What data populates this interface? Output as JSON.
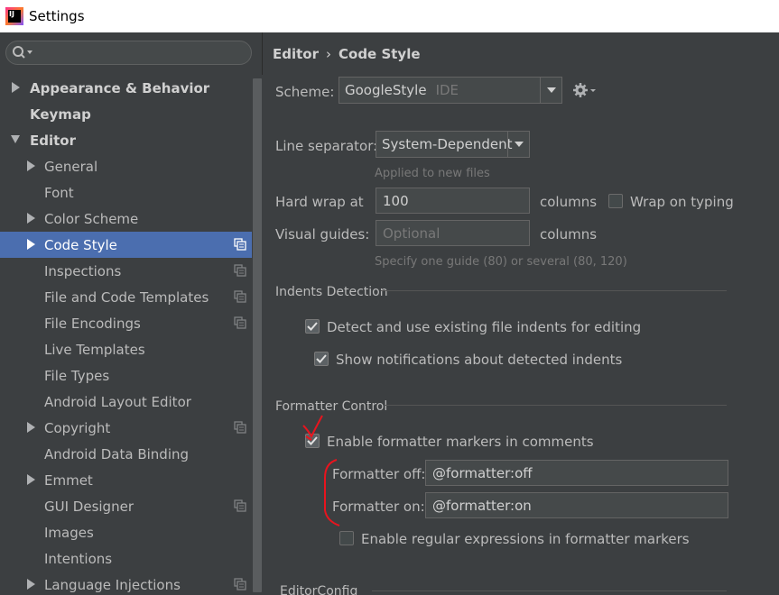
{
  "window": {
    "title": "Settings"
  },
  "search": {
    "placeholder": ""
  },
  "sidebar": {
    "items": [
      {
        "label": "Appearance & Behavior",
        "level": 0,
        "arrow": "right",
        "selected": false,
        "copy": false
      },
      {
        "label": "Keymap",
        "level": 0,
        "arrow": "none",
        "selected": false,
        "copy": false
      },
      {
        "label": "Editor",
        "level": 0,
        "arrow": "down",
        "selected": false,
        "copy": false
      },
      {
        "label": "General",
        "level": 1,
        "arrow": "right",
        "selected": false,
        "copy": false
      },
      {
        "label": "Font",
        "level": 1,
        "arrow": "none",
        "selected": false,
        "copy": false
      },
      {
        "label": "Color Scheme",
        "level": 1,
        "arrow": "right",
        "selected": false,
        "copy": false
      },
      {
        "label": "Code Style",
        "level": 1,
        "arrow": "right",
        "selected": true,
        "copy": true
      },
      {
        "label": "Inspections",
        "level": 1,
        "arrow": "none",
        "selected": false,
        "copy": true
      },
      {
        "label": "File and Code Templates",
        "level": 1,
        "arrow": "none",
        "selected": false,
        "copy": true
      },
      {
        "label": "File Encodings",
        "level": 1,
        "arrow": "none",
        "selected": false,
        "copy": true
      },
      {
        "label": "Live Templates",
        "level": 1,
        "arrow": "none",
        "selected": false,
        "copy": false
      },
      {
        "label": "File Types",
        "level": 1,
        "arrow": "none",
        "selected": false,
        "copy": false
      },
      {
        "label": "Android Layout Editor",
        "level": 1,
        "arrow": "none",
        "selected": false,
        "copy": false
      },
      {
        "label": "Copyright",
        "level": 1,
        "arrow": "right",
        "selected": false,
        "copy": true
      },
      {
        "label": "Android Data Binding",
        "level": 1,
        "arrow": "none",
        "selected": false,
        "copy": false
      },
      {
        "label": "Emmet",
        "level": 1,
        "arrow": "right",
        "selected": false,
        "copy": false
      },
      {
        "label": "GUI Designer",
        "level": 1,
        "arrow": "none",
        "selected": false,
        "copy": true
      },
      {
        "label": "Images",
        "level": 1,
        "arrow": "none",
        "selected": false,
        "copy": false
      },
      {
        "label": "Intentions",
        "level": 1,
        "arrow": "none",
        "selected": false,
        "copy": false
      },
      {
        "label": "Language Injections",
        "level": 1,
        "arrow": "right",
        "selected": false,
        "copy": true
      }
    ]
  },
  "breadcrumb": {
    "first": "Editor",
    "separator": "›",
    "second": "Code Style"
  },
  "scheme": {
    "label": "Scheme:",
    "value": "GoogleStyle",
    "scope": "IDE"
  },
  "line_separator": {
    "label": "Line separator:",
    "value": "System-Dependent",
    "hint": "Applied to new files"
  },
  "hard_wrap": {
    "label": "Hard wrap at",
    "value": "100",
    "unit": "columns",
    "wrap_on_typing_label": "Wrap on typing",
    "wrap_on_typing_checked": false
  },
  "visual_guides": {
    "label": "Visual guides:",
    "placeholder": "Optional",
    "unit": "columns",
    "hint": "Specify one guide (80) or several (80, 120)"
  },
  "indents_detection": {
    "title": "Indents Detection",
    "detect_label": "Detect and use existing file indents for editing",
    "detect_checked": true,
    "notify_label": "Show notifications about detected indents",
    "notify_checked": true
  },
  "formatter_control": {
    "title": "Formatter Control",
    "enable_label": "Enable formatter markers in comments",
    "enable_checked": true,
    "off_label": "Formatter off:",
    "off_value": "@formatter:off",
    "on_label": "Formatter on:",
    "on_value": "@formatter:on",
    "regex_label": "Enable regular expressions in formatter markers",
    "regex_checked": false
  },
  "editorconfig": {
    "title": "EditorConfig"
  },
  "colors": {
    "selection": "#4b6eaf",
    "annotation": "#e8141e",
    "background": "#3c3f41"
  }
}
